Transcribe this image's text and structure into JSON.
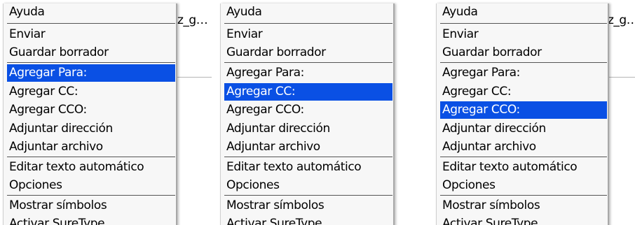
{
  "background_fragment": "z_g…",
  "colors": {
    "menu_bg": "#f7f7f7",
    "selected_bg": "#0a50e4",
    "selected_text": "#ffffff",
    "text": "#000000"
  },
  "menus": [
    {
      "selected": "Agregar Para:",
      "items": [
        {
          "label": "Ayuda"
        },
        {
          "label": "Enviar"
        },
        {
          "label": "Guardar borrador"
        },
        {
          "label": "Agregar Para:"
        },
        {
          "label": "Agregar CC:"
        },
        {
          "label": "Agregar CCO:"
        },
        {
          "label": "Adjuntar dirección"
        },
        {
          "label": "Adjuntar archivo"
        },
        {
          "label": "Editar texto automático"
        },
        {
          "label": "Opciones"
        },
        {
          "label": "Mostrar símbolos"
        },
        {
          "label": "Activar SureType"
        }
      ]
    },
    {
      "selected": "Agregar CC:",
      "items": [
        {
          "label": "Ayuda"
        },
        {
          "label": "Enviar"
        },
        {
          "label": "Guardar borrador"
        },
        {
          "label": "Agregar Para:"
        },
        {
          "label": "Agregar CC:"
        },
        {
          "label": "Agregar CCO:"
        },
        {
          "label": "Adjuntar dirección"
        },
        {
          "label": "Adjuntar archivo"
        },
        {
          "label": "Editar texto automático"
        },
        {
          "label": "Opciones"
        },
        {
          "label": "Mostrar símbolos"
        },
        {
          "label": "Activar SureType"
        }
      ]
    },
    {
      "selected": "Agregar CCO:",
      "items": [
        {
          "label": "Ayuda"
        },
        {
          "label": "Enviar"
        },
        {
          "label": "Guardar borrador"
        },
        {
          "label": "Agregar Para:"
        },
        {
          "label": "Agregar CC:"
        },
        {
          "label": "Agregar CCO:"
        },
        {
          "label": "Adjuntar dirección"
        },
        {
          "label": "Adjuntar archivo"
        },
        {
          "label": "Editar texto automático"
        },
        {
          "label": "Opciones"
        },
        {
          "label": "Mostrar símbolos"
        },
        {
          "label": "Activar SureType"
        }
      ]
    }
  ]
}
